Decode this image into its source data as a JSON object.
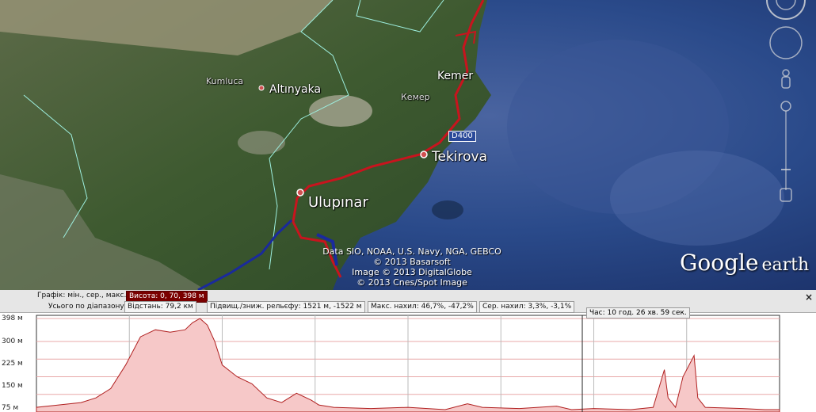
{
  "map": {
    "places": [
      {
        "id": "kumluca",
        "label": "Kumluca"
      },
      {
        "id": "altinyaka",
        "label": "Altınyaka"
      },
      {
        "id": "kemer",
        "label": "Kemer"
      },
      {
        "id": "kemer_small",
        "label": "Кемер"
      },
      {
        "id": "tekirova",
        "label": "Tekirova"
      },
      {
        "id": "ulupinar",
        "label": "Ulupınar"
      }
    ],
    "road_label": "D400",
    "attribution": [
      "Data SIO, NOAA, U.S. Navy, NGA, GEBCO",
      "© 2013 Basarsoft",
      "Image © 2013 DigitalGlobe",
      "© 2013 Cnes/Spot Image"
    ],
    "logo": {
      "google": "Google",
      "earth": "earth"
    },
    "icons": [
      "compass-icon",
      "look-joystick-icon",
      "pegman-icon",
      "zoom-slider-icon"
    ],
    "colors": {
      "route": "#c8141e",
      "track": "#1a2a9c",
      "border": "#9ef0e0",
      "sea": "#1c3c7a"
    }
  },
  "profile": {
    "stats": {
      "graph": "Графік: мін., сер., макс.",
      "height": "Висота: 0, 70, 398 м",
      "total_range": "Усього по діапазону",
      "distance": "Відстань: 79,2 км",
      "climb": "Підвищ./зниж. рельєфу: 1521 м, -1522 м",
      "max_slope": "Макс. нахил: 46,7%, -47,2%",
      "avg_slope": "Сер. нахил: 3,3%, -3,1%",
      "time": "Час: 10 год. 26 хв. 59 сек."
    },
    "close_label": "×",
    "y_ticks": [
      "398 м",
      "300 м",
      "225 м",
      "150 м",
      "75 м"
    ]
  },
  "chart_data": {
    "type": "area",
    "ylim": [
      0,
      398
    ],
    "y_ticks": [
      398,
      300,
      225,
      150,
      75
    ],
    "x_fraction": [
      0.0,
      0.03,
      0.06,
      0.08,
      0.1,
      0.12,
      0.14,
      0.16,
      0.18,
      0.2,
      0.21,
      0.22,
      0.23,
      0.24,
      0.25,
      0.27,
      0.29,
      0.31,
      0.33,
      0.35,
      0.37,
      0.38,
      0.4,
      0.45,
      0.5,
      0.55,
      0.58,
      0.6,
      0.65,
      0.7,
      0.72,
      0.75,
      0.8,
      0.83,
      0.845,
      0.85,
      0.86,
      0.87,
      0.885,
      0.89,
      0.9,
      0.95,
      0.98,
      1.0
    ],
    "y": [
      20,
      30,
      40,
      60,
      100,
      200,
      320,
      350,
      340,
      350,
      380,
      398,
      370,
      300,
      200,
      150,
      120,
      60,
      40,
      80,
      50,
      30,
      20,
      15,
      20,
      10,
      35,
      20,
      15,
      25,
      10,
      15,
      10,
      20,
      180,
      60,
      20,
      150,
      240,
      60,
      20,
      15,
      10,
      10
    ]
  }
}
